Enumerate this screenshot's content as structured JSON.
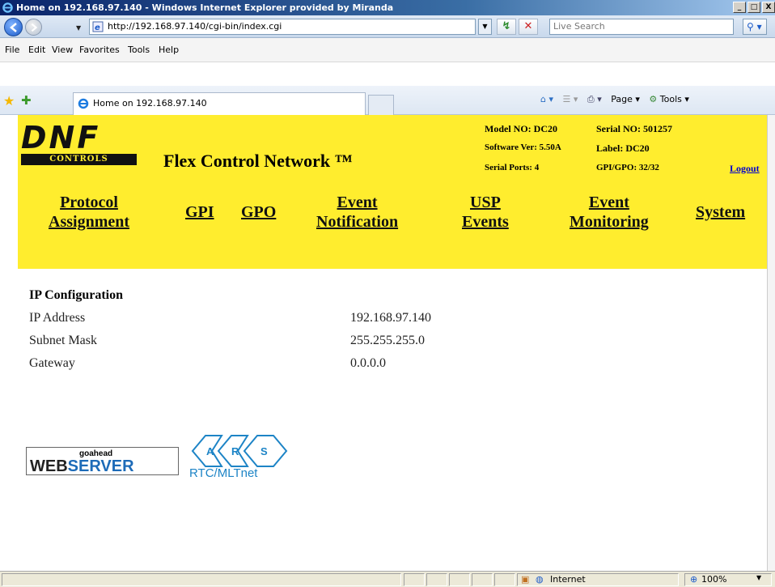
{
  "window": {
    "title": "Home on 192.168.97.140 - Windows Internet Explorer provided by Miranda",
    "min": "_",
    "max": "□",
    "close": "X"
  },
  "address": {
    "url": "http://192.168.97.140/cgi-bin/index.cgi",
    "search_placeholder": "Live Search"
  },
  "menu": [
    "File",
    "Edit",
    "View",
    "Favorites",
    "Tools",
    "Help"
  ],
  "tab": {
    "label": "Home on 192.168.97.140"
  },
  "commandbar": {
    "page": "Page ▾",
    "tools": "Tools ▾"
  },
  "header": {
    "logo_text": "DNF",
    "logo_sub": "CONTROLS",
    "title": "Flex Control Network ™",
    "model": "Model NO: DC20",
    "serial": "Serial NO: 501257",
    "software": "Software Ver: 5.50A",
    "label": "Label: DC20",
    "serial_ports": "Serial Ports: 4",
    "gpi_gpo": "GPI/GPO: 32/32",
    "logout": "Logout"
  },
  "nav": {
    "protocol_1": "Protocol",
    "protocol_2": "Assignment",
    "gpi": "GPI",
    "gpo": "GPO",
    "event_1": "Event",
    "event_2": "Notification",
    "usp_1": "USP",
    "usp_2": "Events",
    "monitor_1": "Event",
    "monitor_2": "Monitoring",
    "system": "System"
  },
  "ip_config": {
    "title": "IP Configuration",
    "rows": [
      {
        "label": "IP Address",
        "value": "192.168.97.140"
      },
      {
        "label": "Subnet Mask",
        "value": "255.255.255.0"
      },
      {
        "label": "Gateway",
        "value": "0.0.0.0"
      }
    ]
  },
  "footer_logos": {
    "goahead_small": "goahead",
    "goahead_web": "WEB",
    "goahead_server": "SERVER",
    "ars_letters": [
      "A",
      "R",
      "S"
    ],
    "ars_caption": "RTC/MLTnet"
  },
  "status": {
    "zone": "Internet",
    "zoom": "100%"
  }
}
